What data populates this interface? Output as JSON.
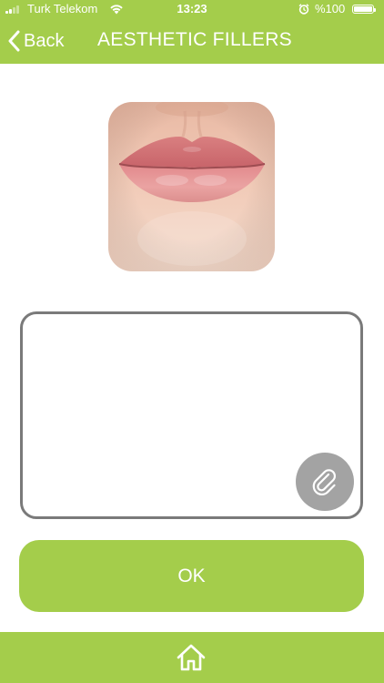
{
  "status_bar": {
    "carrier": "Turk Telekom",
    "time": "13:23",
    "battery_percent": "%100",
    "battery_level": 1.0,
    "icons": [
      "signal-icon",
      "wifi-icon",
      "alarm-icon",
      "battery-icon"
    ]
  },
  "nav": {
    "back_label": "Back",
    "title": "AESTHETIC FILLERS",
    "back_icon": "chevron-left-icon"
  },
  "product": {
    "image": "lips-photo"
  },
  "message": {
    "value": "",
    "placeholder": "",
    "attach_icon": "paperclip-icon"
  },
  "actions": {
    "ok_label": "OK"
  },
  "footer": {
    "home_icon": "home-icon"
  },
  "colors": {
    "brand_green": "#a4cd4b",
    "border_gray": "#7a7a7a",
    "attach_gray": "#a3a3a3",
    "white": "#ffffff"
  }
}
